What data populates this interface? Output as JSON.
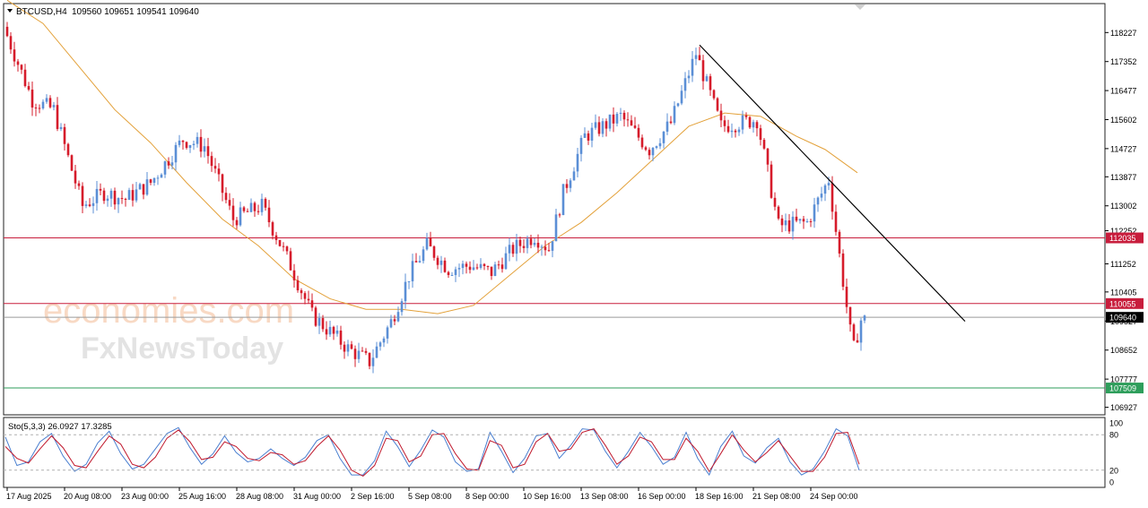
{
  "header": {
    "symbol": "BTCUSD,H4",
    "ohlc": "109560 109651 109541 109640"
  },
  "watermark": {
    "line1": "economies.com",
    "line2": "FxNewsToday"
  },
  "colors": {
    "bull": "#5b8fd6",
    "bear": "#d61c2b",
    "ma": "#e3a13a",
    "resistance_1": "#c81d3c",
    "resistance_2": "#c81d3c",
    "support": "#2e9e5b",
    "trendline": "#000000",
    "stoch_main": "#4a7fd0",
    "stoch_signal": "#c0182c"
  },
  "chart_data": [
    {
      "type": "candlestick",
      "title": "BTCUSD,H4",
      "y_ticks": [
        118227,
        117352,
        116477,
        115602,
        114727,
        113877,
        113002,
        112252,
        111252,
        110405,
        109527,
        108652,
        107777,
        106927
      ],
      "ylim": [
        106800,
        119000
      ],
      "x_ticks": [
        "17 Aug 2025",
        "20 Aug 08:00",
        "23 Aug 00:00",
        "25 Aug 16:00",
        "28 Aug 08:00",
        "31 Aug 00:00",
        "2 Sep 16:00",
        "5 Sep 08:00",
        "8 Sep 00:00",
        "10 Sep 16:00",
        "13 Sep 08:00",
        "16 Sep 00:00",
        "18 Sep 16:00",
        "21 Sep 08:00",
        "24 Sep 00:00"
      ],
      "horizontal_levels": [
        {
          "label": "112035",
          "value": 112035,
          "color_key": "resistance_1"
        },
        {
          "label": "110055",
          "value": 110055,
          "color_key": "resistance_2"
        },
        {
          "label": "109640",
          "value": 109640,
          "color_key": "current"
        },
        {
          "label": "107509",
          "value": 107509,
          "color_key": "support"
        }
      ],
      "trendline": {
        "start": {
          "bar": 193,
          "price": 117850
        },
        "end": {
          "bar": 267,
          "price": 109520
        }
      },
      "moving_average": {
        "path": [
          [
            0,
            119200
          ],
          [
            10,
            118500
          ],
          [
            20,
            117200
          ],
          [
            30,
            115900
          ],
          [
            40,
            114900
          ],
          [
            50,
            113700
          ],
          [
            60,
            112600
          ],
          [
            70,
            111800
          ],
          [
            80,
            110800
          ],
          [
            90,
            110200
          ],
          [
            100,
            109880
          ],
          [
            110,
            109880
          ],
          [
            120,
            109750
          ],
          [
            130,
            110000
          ],
          [
            140,
            110900
          ],
          [
            150,
            111800
          ],
          [
            160,
            112500
          ],
          [
            170,
            113400
          ],
          [
            180,
            114400
          ],
          [
            190,
            115400
          ],
          [
            200,
            115800
          ],
          [
            210,
            115700
          ],
          [
            220,
            115100
          ],
          [
            228,
            114700
          ],
          [
            237,
            114000
          ]
        ]
      },
      "price_path": [
        [
          0,
          118400
        ],
        [
          8,
          116200
        ],
        [
          14,
          115900
        ],
        [
          22,
          113000
        ],
        [
          28,
          113400
        ],
        [
          34,
          113200
        ],
        [
          41,
          113700
        ],
        [
          50,
          115000
        ],
        [
          56,
          114800
        ],
        [
          64,
          112600
        ],
        [
          72,
          113000
        ],
        [
          80,
          111200
        ],
        [
          86,
          109700
        ],
        [
          90,
          109300
        ],
        [
          96,
          108700
        ],
        [
          102,
          108300
        ],
        [
          108,
          109500
        ],
        [
          113,
          110900
        ],
        [
          118,
          111800
        ],
        [
          124,
          111100
        ],
        [
          130,
          111200
        ],
        [
          136,
          111000
        ],
        [
          142,
          111700
        ],
        [
          148,
          112100
        ],
        [
          152,
          111700
        ],
        [
          156,
          113400
        ],
        [
          162,
          115100
        ],
        [
          172,
          115700
        ],
        [
          180,
          114700
        ],
        [
          186,
          115500
        ],
        [
          193,
          117600
        ],
        [
          200,
          115400
        ],
        [
          210,
          115600
        ],
        [
          216,
          112400
        ],
        [
          224,
          112500
        ],
        [
          230,
          113800
        ],
        [
          236,
          109200
        ],
        [
          237,
          108700
        ],
        [
          239,
          109560
        ]
      ]
    },
    {
      "type": "line",
      "title": "Sto(5,3,3) 26.0927 17.3285",
      "ylim": [
        0,
        100
      ],
      "y_ticks": [
        100,
        80,
        20,
        0
      ],
      "levels": [
        80,
        20
      ],
      "series": [
        {
          "key": "main",
          "values": [
            76,
            28,
            34,
            68,
            82,
            44,
            18,
            30,
            66,
            86,
            48,
            22,
            30,
            56,
            82,
            92,
            58,
            30,
            48,
            78,
            50,
            34,
            40,
            56,
            40,
            28,
            42,
            70,
            80,
            40,
            12,
            12,
            36,
            86,
            60,
            26,
            54,
            88,
            76,
            34,
            18,
            22,
            84,
            52,
            16,
            40,
            78,
            82,
            40,
            62,
            90,
            88,
            52,
            24,
            52,
            84,
            60,
            30,
            42,
            84,
            40,
            12,
            60,
            86,
            44,
            32,
            58,
            74,
            34,
            12,
            22,
            52,
            90,
            78,
            20
          ]
        },
        {
          "key": "signal",
          "values": [
            60,
            40,
            32,
            56,
            78,
            58,
            28,
            24,
            52,
            78,
            64,
            30,
            24,
            42,
            74,
            88,
            68,
            38,
            42,
            68,
            60,
            40,
            36,
            50,
            46,
            30,
            36,
            60,
            78,
            54,
            20,
            10,
            28,
            74,
            70,
            34,
            44,
            80,
            82,
            48,
            22,
            20,
            70,
            62,
            24,
            30,
            68,
            82,
            52,
            56,
            84,
            90,
            62,
            30,
            44,
            76,
            68,
            38,
            38,
            74,
            52,
            18,
            48,
            80,
            54,
            34,
            50,
            70,
            44,
            18,
            18,
            42,
            82,
            84,
            30
          ]
        }
      ]
    }
  ]
}
